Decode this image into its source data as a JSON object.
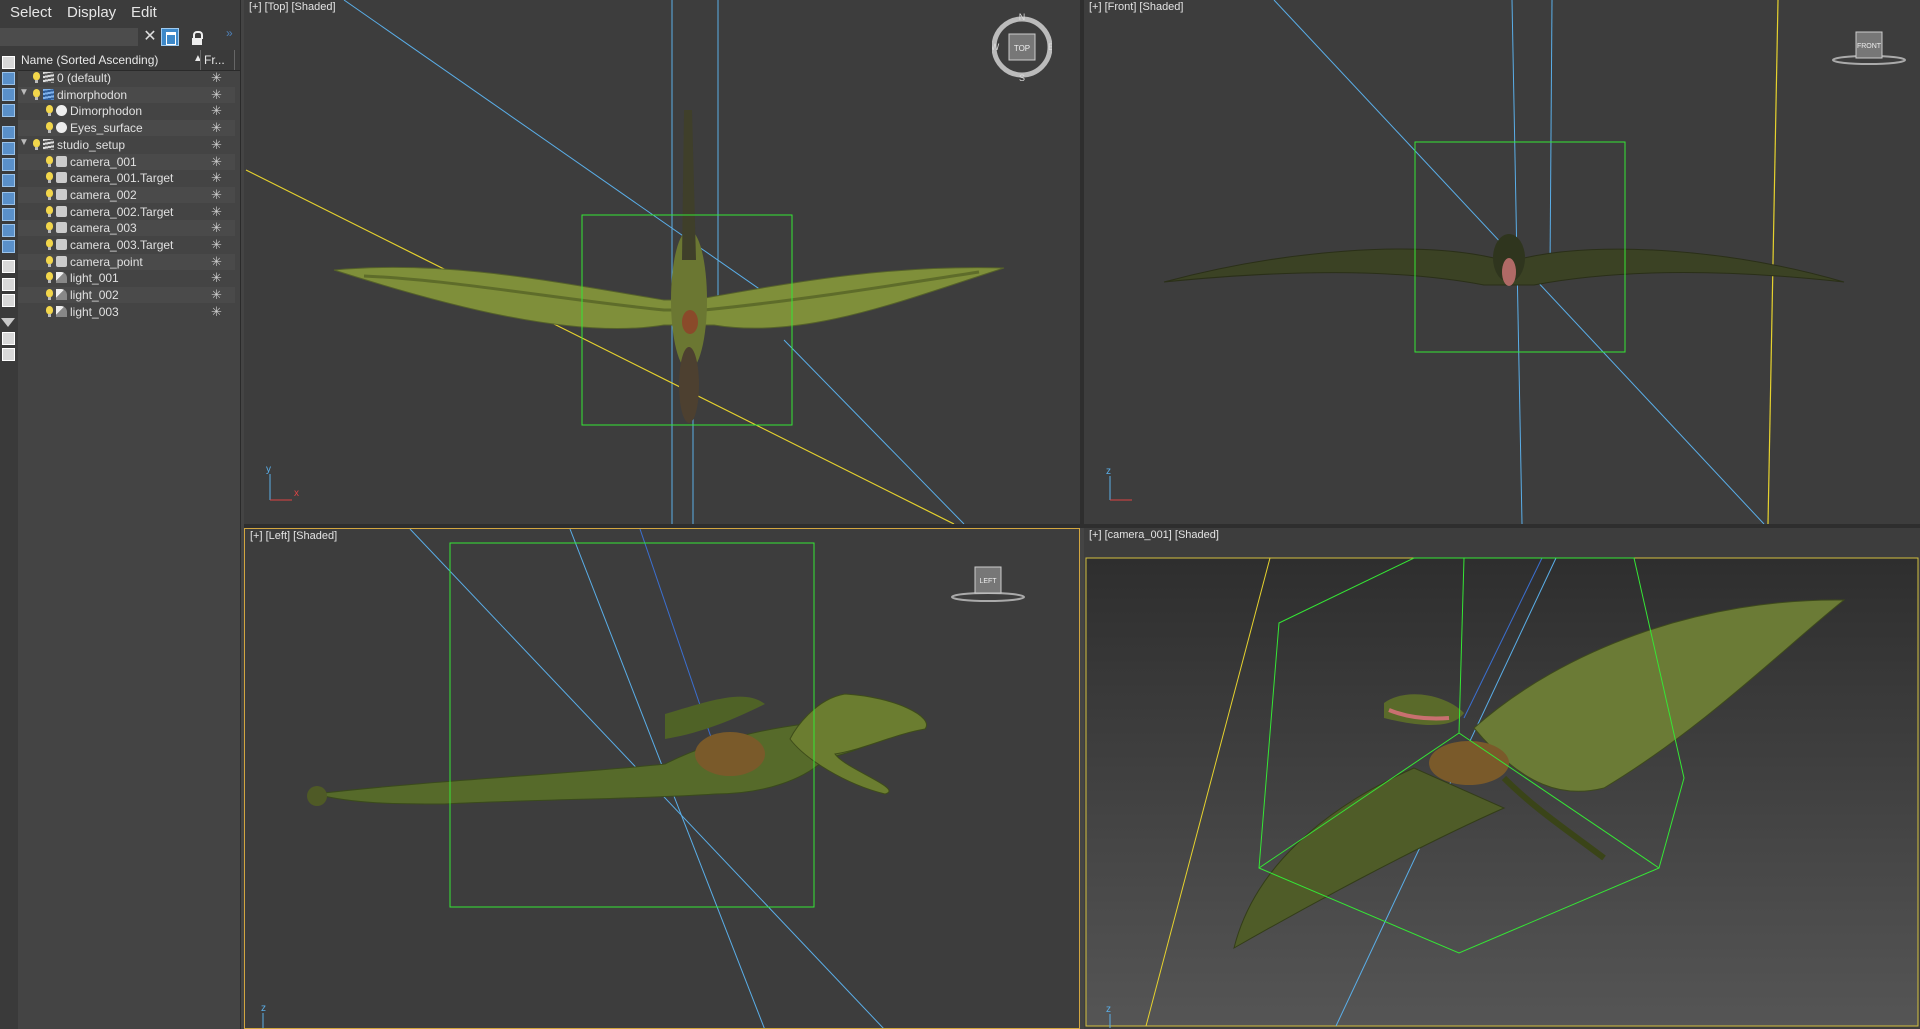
{
  "menu": {
    "select": "Select",
    "display": "Display",
    "edit": "Edit"
  },
  "search": {
    "value": ""
  },
  "toolbar": {
    "clear": "✕",
    "expand": "»"
  },
  "columns": {
    "name": "Name (Sorted Ascending)",
    "sort_arrow": "▲",
    "freeze": "Fr..."
  },
  "tree": [
    {
      "label": "0 (default)",
      "type": "layer",
      "depth": 0,
      "expander": ""
    },
    {
      "label": "dimorphodon",
      "type": "layer-blue",
      "depth": 0,
      "expander": "▼"
    },
    {
      "label": "Dimorphodon",
      "type": "geo",
      "depth": 1,
      "expander": ""
    },
    {
      "label": "Eyes_surface",
      "type": "geo",
      "depth": 1,
      "expander": ""
    },
    {
      "label": "studio_setup",
      "type": "layer",
      "depth": 0,
      "expander": "▼"
    },
    {
      "label": "camera_001",
      "type": "cam",
      "depth": 1,
      "expander": ""
    },
    {
      "label": "camera_001.Target",
      "type": "cam",
      "depth": 1,
      "expander": ""
    },
    {
      "label": "camera_002",
      "type": "cam",
      "depth": 1,
      "expander": ""
    },
    {
      "label": "camera_002.Target",
      "type": "cam",
      "depth": 1,
      "expander": ""
    },
    {
      "label": "camera_003",
      "type": "cam",
      "depth": 1,
      "expander": ""
    },
    {
      "label": "camera_003.Target",
      "type": "cam",
      "depth": 1,
      "expander": ""
    },
    {
      "label": "camera_point",
      "type": "cam",
      "depth": 1,
      "expander": ""
    },
    {
      "label": "light_001",
      "type": "light",
      "depth": 1,
      "expander": ""
    },
    {
      "label": "light_002",
      "type": "light",
      "depth": 1,
      "expander": ""
    },
    {
      "label": "light_003",
      "type": "light",
      "depth": 1,
      "expander": ""
    }
  ],
  "freeze_icon": "✳",
  "viewports": {
    "top": {
      "label": "[+] [Top] [Shaded]",
      "cube": "TOP",
      "compass": {
        "n": "N",
        "s": "S",
        "e": "E",
        "w": "W"
      }
    },
    "front": {
      "label": "[+] [Front] [Shaded]",
      "cube": "FRONT"
    },
    "left": {
      "label": "[+] [Left] [Shaded]",
      "cube": "LEFT"
    },
    "camera": {
      "label": "[+] [camera_001] [Shaded]"
    }
  },
  "axis": {
    "x": "x",
    "y": "y",
    "z": "z"
  },
  "colors": {
    "selection": "#35e635",
    "camera_line": "#5aaee8",
    "light_line": "#e6d22e",
    "creature": "#7c8a3a",
    "active_border": "#d2a640"
  }
}
